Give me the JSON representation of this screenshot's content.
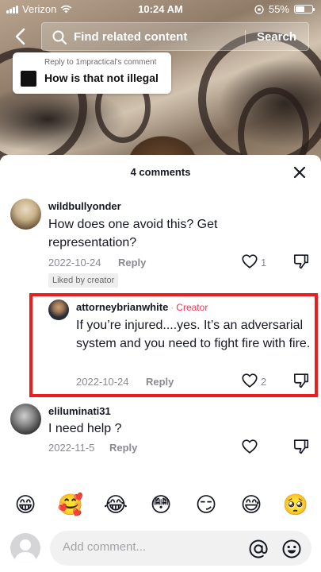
{
  "status_bar": {
    "carrier": "Verizon",
    "time": "10:24 AM",
    "battery": "55%",
    "battery_level": 0.55
  },
  "search": {
    "placeholder": "Find related content",
    "button_label": "Search"
  },
  "reply_bubble": {
    "context": "Reply to 1mpractical's comment",
    "text": "How is that not illegal"
  },
  "sheet": {
    "title": "4 comments"
  },
  "comments": [
    {
      "username": "wildbullyonder",
      "text": "How does one avoid this? Get representation?",
      "date": "2022-10-24",
      "reply_label": "Reply",
      "likes": "1",
      "badge": "Liked by creator"
    },
    {
      "username": "attorneybrianwhite",
      "dot": "·",
      "tag": "Creator",
      "text": "If you’re injured....yes. It’s an adversarial system and you need to fight fire with fire.",
      "date": "2022-10-24",
      "reply_label": "Reply",
      "likes": "2"
    },
    {
      "username": "eliluminati31",
      "text": "I need help ?",
      "date": "2022-11-5",
      "reply_label": "Reply"
    }
  ],
  "emojis": [
    "😁",
    "🥰",
    "😂",
    "😳",
    "😏",
    "😅",
    "🥺"
  ],
  "composer": {
    "placeholder": "Add comment..."
  },
  "colors": {
    "creator_tag": "#fe2c55",
    "highlight_box": "#ee1c1c"
  }
}
